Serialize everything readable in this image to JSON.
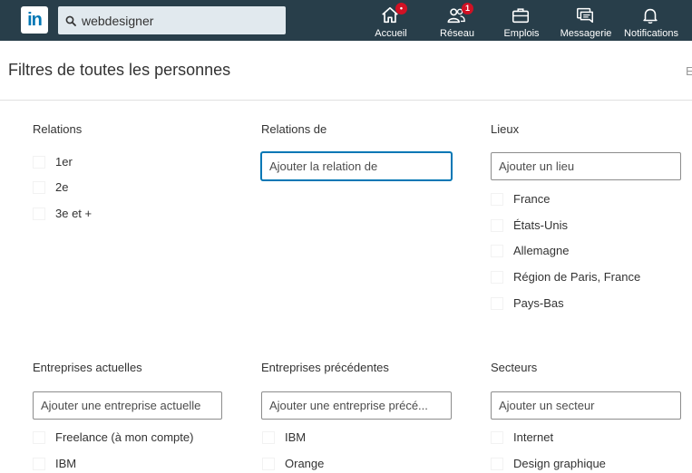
{
  "nav": {
    "logo": "in",
    "search": {
      "value": "webdesigner"
    },
    "items": [
      {
        "label": "Accueil",
        "badge": "•"
      },
      {
        "label": "Réseau",
        "badge": "1"
      },
      {
        "label": "Emplois"
      },
      {
        "label": "Messagerie"
      },
      {
        "label": "Notifications"
      }
    ]
  },
  "header": {
    "title": "Filtres de toutes les personnes",
    "cut": "E"
  },
  "filters": {
    "relations": {
      "title": "Relations",
      "options": [
        "1er",
        "2e",
        "3e et +"
      ]
    },
    "relations_de": {
      "title": "Relations de",
      "placeholder": "Ajouter la relation de"
    },
    "lieux": {
      "title": "Lieux",
      "placeholder": "Ajouter un lieu",
      "options": [
        "France",
        "États-Unis",
        "Allemagne",
        "Région de Paris, France",
        "Pays-Bas"
      ]
    },
    "entreprises_actuelles": {
      "title": "Entreprises actuelles",
      "placeholder": "Ajouter une entreprise actuelle",
      "options": [
        "Freelance (à mon compte)",
        "IBM"
      ]
    },
    "entreprises_precedentes": {
      "title": "Entreprises précédentes",
      "placeholder": "Ajouter une entreprise précé...",
      "options": [
        "IBM",
        "Orange"
      ]
    },
    "secteurs": {
      "title": "Secteurs",
      "placeholder": "Ajouter un secteur",
      "options": [
        "Internet",
        "Design graphique"
      ]
    }
  },
  "colors": {
    "navbar": "#283e4a",
    "accent": "#0077b5",
    "badge": "#d11124"
  }
}
